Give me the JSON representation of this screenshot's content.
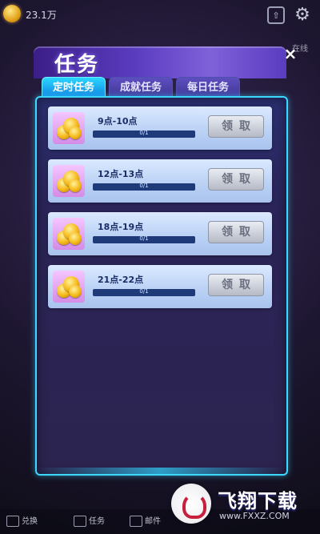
{
  "status": {
    "coins": "23.1万"
  },
  "dialog": {
    "title": "任务",
    "close": "×",
    "tabs": [
      {
        "label": "定时任务",
        "active": true
      },
      {
        "label": "成就任务",
        "active": false
      },
      {
        "label": "每日任务",
        "active": false
      }
    ],
    "tasks": [
      {
        "time": "9点-10点",
        "progress": "0/1",
        "progress_fraction": 0,
        "claim": "领取"
      },
      {
        "time": "12点-13点",
        "progress": "0/1",
        "progress_fraction": 0,
        "claim": "领取"
      },
      {
        "time": "18点-19点",
        "progress": "0/1",
        "progress_fraction": 0,
        "claim": "领取"
      },
      {
        "time": "21点-22点",
        "progress": "0/1",
        "progress_fraction": 0,
        "claim": "领取"
      }
    ]
  },
  "side": {
    "label": "在线"
  },
  "bottom_nav": [
    {
      "label": "兑换"
    },
    {
      "label": "任务"
    },
    {
      "label": "邮件"
    }
  ],
  "watermark": {
    "title": "飞翔下载",
    "url": "www.FXXZ.COM"
  },
  "colors": {
    "accent_tab": "#1eb6ff",
    "panel_border": "#3bd8ff",
    "dialog_title": "#5a3cc0"
  },
  "icons": [
    "coin-icon",
    "share-icon",
    "gear-icon",
    "close-icon",
    "exchange-icon",
    "task-icon",
    "mail-icon"
  ]
}
